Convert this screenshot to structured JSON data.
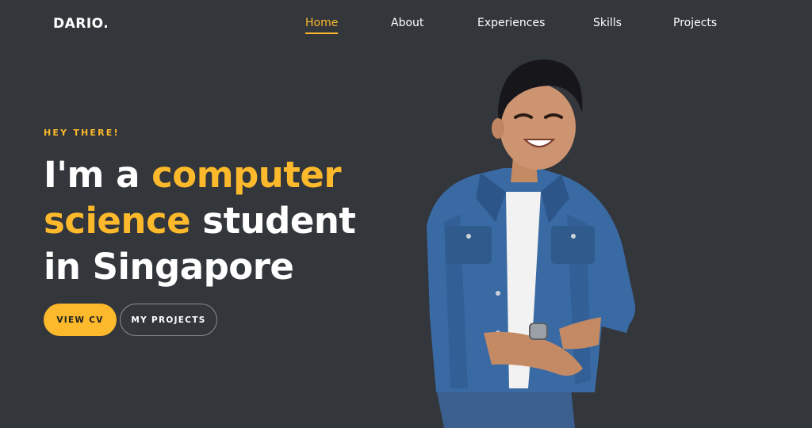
{
  "nav": {
    "logo": "DARIO.",
    "links": [
      {
        "label": "Home",
        "active": true
      },
      {
        "label": "About",
        "active": false
      },
      {
        "label": "Experiences",
        "active": false
      },
      {
        "label": "Skills",
        "active": false
      },
      {
        "label": "Projects",
        "active": false
      }
    ]
  },
  "hero": {
    "eyebrow": "HEY THERE!",
    "headline": {
      "part1": "I'm a ",
      "accent1": "computer",
      "accent2": "science",
      "part2": " student",
      "part3": "in Singapore"
    },
    "buttons": {
      "primary": "VIEW CV",
      "secondary": "MY PROJECTS"
    }
  },
  "colors": {
    "background": "#33363b",
    "accent": "#fbb92b",
    "text": "#ffffff"
  }
}
